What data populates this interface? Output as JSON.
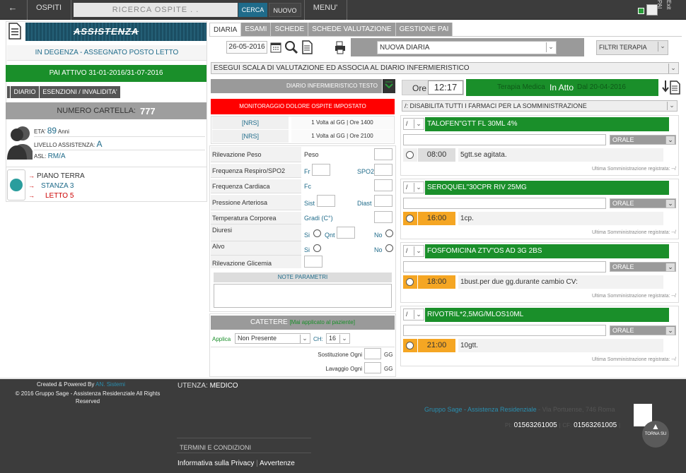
{
  "topbar": {
    "back": "←",
    "ospiti": "OSPITI",
    "search_placeholder": "RICERCA OSPITE . .",
    "cerca": "CERCA",
    "nuovo": "NUOVO",
    "menu": "MENU'",
    "pai": "PAI",
    "exit": "Exit"
  },
  "left": {
    "logo_text": "ASSISTENZA",
    "status": "IN DEGENZA - ASSEGNATO POSTO LETTO",
    "pai": "PAI ATTIVO 31-01-2016/31-07-2016",
    "tabs": [
      "DIARIO",
      "ESENZIONI / INVALIDITA'"
    ],
    "cartella_label": "NUMERO CARTELLA:",
    "cartella": "777",
    "eta_label": "ETA'",
    "eta": "89",
    "anni": "Anni",
    "livello_label": "LIVELLO ASSISTENZA:",
    "livello": "A",
    "asl_label": "ASL:",
    "asl": "RM/A",
    "piano": "PIANO TERRA",
    "stanza": "STANZA 3",
    "letto": "LETTO 5"
  },
  "tabs": [
    "DIARIA",
    "ESAMI",
    "SCHEDE",
    "SCHEDE VALUTAZIONE",
    "GESTIONE PAI"
  ],
  "diario": {
    "date": "26-05-2016",
    "nuova_diaria": "NUOVA DIARIA",
    "filtri": "FILTRI TERAPIA",
    "scala": "ESEGUI SCALA DI VALUTAZIONE ED ASSOCIA AL DIARIO INFERMIERISTICO",
    "diario_testo": "DIARIO INFERMIERISTICO TESTO",
    "dolore": "MONITORAGGIO DOLORE OSPITE IMPOSTATO",
    "nrs": [
      {
        "tag": "[NRS]",
        "desc": "1 Volta al GG | Ore 1400"
      },
      {
        "tag": "[NRS]",
        "desc": "1 Volta al GG | Ore 2100"
      }
    ],
    "params": {
      "peso_label": "Rilevazione Peso",
      "peso": "Peso",
      "freq_resp_label": "Frequenza Respiro/SPO2",
      "fr": "Fr",
      "spo2": "SPO2",
      "freq_card_label": "Frequenza Cardiaca",
      "fc": "Fc",
      "press_label": "Pressione Arteriosa",
      "sist": "Sist",
      "diast": "Diast",
      "temp_label": "Temperatura Corporea",
      "gradi": "Gradi (C°)",
      "diuresi_label": "Diuresi",
      "si": "Si",
      "qnt": "Qnt",
      "no": "No",
      "alvo_label": "Alvo",
      "glic_label": "Rilevazione Glicemia",
      "note": "NOTE PARAMETRI"
    },
    "catetere": {
      "title": "CATETERE",
      "note": "[Mai applicato al paziente]",
      "applica": "Applica",
      "stato": "Non Presente",
      "ch": "CH:",
      "ch_val": "16",
      "sost": "Sostituzione Ogni",
      "lav": "Lavaggio Ogni",
      "gg": "GG"
    }
  },
  "terapia": {
    "ore_label": "Ore",
    "ore": "12:17",
    "terapia_label": "Terapia Medica",
    "stato": "In Atto",
    "dal": "Dal 20-04-2016",
    "disabilita": "/: DISABILITA TUTTI I FARMACI PER LA SOMMINISTRAZIONE",
    "ultima": "Ultima Somministrazione registrata: --/",
    "drugs": [
      {
        "sel": "/",
        "name": "TALOFEN\"GTT FL 30ML 4%",
        "via": "ORALE",
        "time": "08:00",
        "dose": "5gtt.se agitata.",
        "orange": false
      },
      {
        "sel": "/",
        "name": "SEROQUEL\"30CPR RIV 25MG",
        "via": "ORALE",
        "time": "16:00",
        "dose": "1cp.",
        "orange": true
      },
      {
        "sel": "/",
        "name": "FOSFOMICINA ZTV\"OS AD 3G 2BS",
        "via": "ORALE",
        "time": "18:00",
        "dose": "1bust.per due gg.durante cambio CV:",
        "orange": true
      },
      {
        "sel": "/",
        "name": "RIVOTRIL*2,5MG/MLOS10ML",
        "via": "ORALE",
        "time": "21:00",
        "dose": "10gtt.",
        "orange": true
      }
    ]
  },
  "footer": {
    "created": "Created & Powered By",
    "author": "AN. Sistemi",
    "copy_prefix": "© 2016",
    "company": "Gruppo Sage - Assistenza Residenziale",
    "rights": "All Rights Reserved",
    "utenza_label": "UTENZA:",
    "utenza": "MEDICO",
    "addr_company": "Gruppo Sage - Assistenza Residenziale",
    "addr": "- Via Portuense, 746 Roma",
    "pi_label": "PI:",
    "pi": "01563261005",
    "cf_label": "CF:",
    "cf": "01563261005",
    "termini": "TERMINI E CONDIZIONI",
    "privacy": "Informativa sulla Privacy",
    "avvertenze": "Avvertenze",
    "torna": "TORNA SU"
  }
}
